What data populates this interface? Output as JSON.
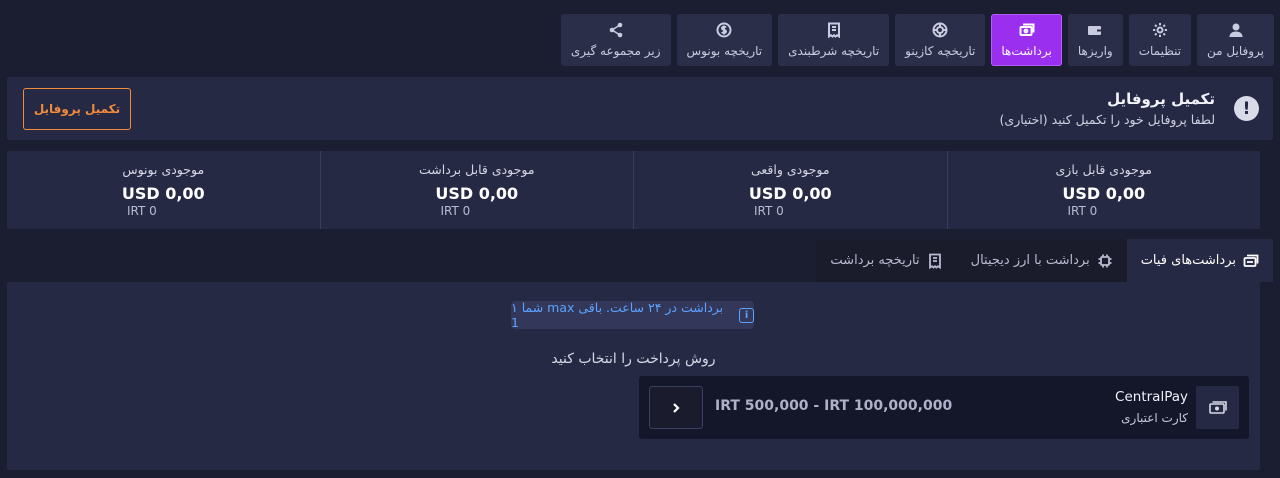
{
  "tabs": [
    {
      "id": "profile",
      "label": "پروفایل من",
      "icon": "user-icon"
    },
    {
      "id": "settings",
      "label": "تنظیمات",
      "icon": "gear-icon"
    },
    {
      "id": "deposits",
      "label": "واریزها",
      "icon": "wallet-icon"
    },
    {
      "id": "withdrawals",
      "label": "برداشت‌ها",
      "icon": "withdraw-icon",
      "active": true
    },
    {
      "id": "casino_history",
      "label": "تاریخچه کازینو",
      "icon": "casino-chip-icon"
    },
    {
      "id": "bet_history",
      "label": "تاریخچه شرطبندی",
      "icon": "bet-slip-icon"
    },
    {
      "id": "bonus_history",
      "label": "تاریخچه بونوس",
      "icon": "dollar-coin-icon"
    },
    {
      "id": "referrals",
      "label": "زیر مجموعه گیری",
      "icon": "share-icon"
    }
  ],
  "profile_alert": {
    "title": "تکمیل پروفایل",
    "subtitle": "لطفا پروفایل خود را تکمیل کنید (اختیاری)",
    "button": "تکمیل پروفایل",
    "icon": "exclamation-circle-icon"
  },
  "balances": [
    {
      "label": "موجودی قابل بازی",
      "usd": "USD 0,00",
      "irt": "IRT 0"
    },
    {
      "label": "موجودی واقعی",
      "usd": "USD 0,00",
      "irt": "IRT 0"
    },
    {
      "label": "موجودی قابل برداشت",
      "usd": "USD 0,00",
      "irt": "IRT 0"
    },
    {
      "label": "موجودی بونوس",
      "usd": "USD 0,00",
      "irt": "IRT 0"
    }
  ],
  "withdraw_tabs": [
    {
      "label": "برداشت‌های فیات",
      "icon": "fiat-withdraw-icon",
      "active": true
    },
    {
      "label": "برداشت با ارز دیجیتال",
      "icon": "crypto-chip-icon"
    },
    {
      "label": "تاریخچه برداشت",
      "icon": "withdraw-history-icon"
    }
  ],
  "limit_notice": "شما ۱ max برداشت در ۲۴ ساعت. باقی 1",
  "choose_method": "روش پرداخت را انتخاب کنید",
  "payment_method": {
    "name": "CentralPay",
    "type": "کارت اعتباری",
    "range": "IRT 500,000 - IRT 100,000,000",
    "icon": "cash-icon"
  },
  "colors": {
    "background": "#1b1d30",
    "panel": "#262943",
    "accent_active": "#9b2ff0",
    "cta_orange": "#f08a3c",
    "info_blue": "#5da2ff"
  }
}
